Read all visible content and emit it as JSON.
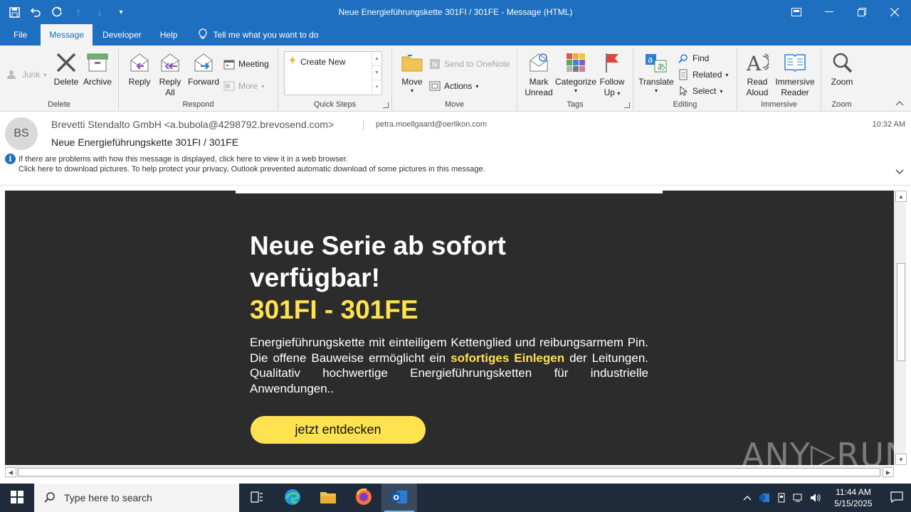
{
  "window": {
    "title": "Neue Energieführungskette 301FI / 301FE  -  Message (HTML)"
  },
  "tabs": [
    {
      "label": "File"
    },
    {
      "label": "Message"
    },
    {
      "label": "Developer"
    },
    {
      "label": "Help"
    }
  ],
  "tell_me": "Tell me what you want to do",
  "ribbon": {
    "delete_group": {
      "label": "Delete",
      "junk": "Junk",
      "delete": "Delete",
      "archive": "Archive"
    },
    "respond_group": {
      "label": "Respond",
      "reply": "Reply",
      "reply_all_1": "Reply",
      "reply_all_2": "All",
      "forward": "Forward",
      "meeting": "Meeting",
      "more": "More"
    },
    "quick_steps_group": {
      "label": "Quick Steps",
      "create_new": "Create New"
    },
    "move_group": {
      "label": "Move",
      "move": "Move",
      "onenote": "Send to OneNote",
      "actions": "Actions"
    },
    "tags_group": {
      "label": "Tags",
      "mark_1": "Mark",
      "mark_2": "Unread",
      "categorize": "Categorize",
      "follow_1": "Follow",
      "follow_2": "Up"
    },
    "editing_group": {
      "label": "Editing",
      "translate": "Translate",
      "find": "Find",
      "related": "Related",
      "select": "Select"
    },
    "immersive_group": {
      "label": "Immersive",
      "read_1": "Read",
      "read_2": "Aloud",
      "reader_1": "Immersive",
      "reader_2": "Reader"
    },
    "zoom_group": {
      "label": "Zoom",
      "zoom": "Zoom"
    }
  },
  "message": {
    "avatar_initials": "BS",
    "sender": "Brevetti Stendalto GmbH <a.bubola@4298792.brevosend.com>",
    "recipient": "petra.moellgaard@oerlikon.com",
    "time": "10:32 AM",
    "subject": "Neue Energieführungskette 301FI / 301FE",
    "info_line1": "If there are problems with how this message is displayed, click here to view it in a web browser.",
    "info_line2": "Click here to download pictures. To help protect your privacy, Outlook prevented automatic download of some pictures in this message."
  },
  "email": {
    "headline_1": "Neue Serie ab sofort",
    "headline_2": "verfügbar!",
    "headline_3": "301FI - 301FE",
    "lead_1": "Energieführungskette mit einteiligem Kettenglied und reibungsarmem Pin. Die offene Bauweise ermöglicht ein ",
    "lead_hl": "sofortiges Einlegen",
    "lead_2": " der Leitungen. Qualitativ hochwertige Energieführungsketten für industrielle Anwendungen..",
    "cta": "jetzt entdecken"
  },
  "watermark": "ANY▷RUN",
  "taskbar": {
    "search_placeholder": "Type here to search",
    "time": "11:44 AM",
    "date": "5/15/2025"
  },
  "colors": {
    "accent": "#1e6fbf",
    "email_bg": "#2c2c2c",
    "highlight": "#ffe24f"
  }
}
